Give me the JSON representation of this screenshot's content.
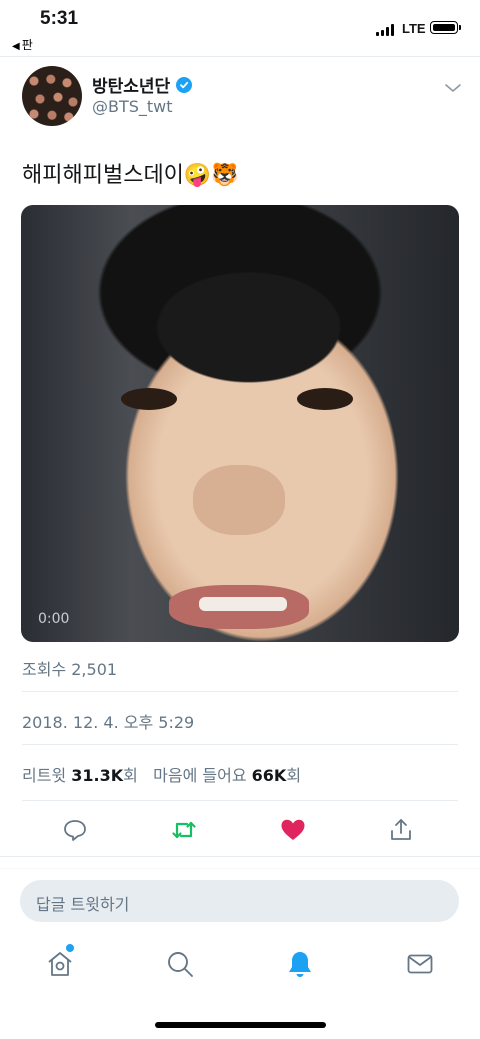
{
  "status_bar": {
    "time": "5:31",
    "back_app": "판",
    "network": "LTE"
  },
  "tweet": {
    "display_name": "방탄소년단",
    "handle": "@BTS_twt",
    "text": "해피해피벌스데이🤪🐯",
    "video_time": "0:00",
    "views": "조회수 2,501",
    "timestamp": "2018. 12. 4. 오후 5:29",
    "retweets_label": "리트윗",
    "retweets_count": "31.3K",
    "retweets_suffix": "회",
    "likes_label": "마음에 들어요",
    "likes_count": "66K",
    "likes_suffix": "회"
  },
  "actions": {
    "reply_icon": "reply-icon",
    "retweet_icon": "retweet-icon",
    "like_icon": "heart-icon",
    "share_icon": "share-icon",
    "retweet_color": "#17bf63",
    "like_color": "#e0245e"
  },
  "reply_box": {
    "placeholder": "답글 트윗하기"
  },
  "tab_bar": {
    "tabs": [
      "home-icon",
      "search-icon",
      "notifications-icon",
      "messages-icon"
    ],
    "active": "notifications-icon",
    "accent": "#1da1f2"
  }
}
